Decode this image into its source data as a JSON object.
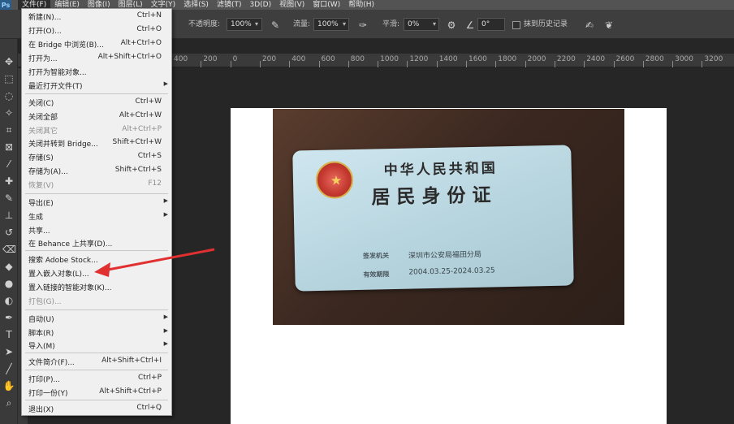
{
  "menubar": {
    "logo": "Ps",
    "items": [
      "文件(F)",
      "编辑(E)",
      "图像(I)",
      "图层(L)",
      "文字(Y)",
      "选择(S)",
      "滤镜(T)",
      "3D(D)",
      "视图(V)",
      "窗口(W)",
      "帮助(H)"
    ]
  },
  "options": {
    "opacity_label": "不透明度:",
    "opacity_value": "100%",
    "flow_label": "流量:",
    "flow_value": "100%",
    "smoothing_label": "平滑:",
    "smoothing_value": "0%",
    "angle_value": "0°",
    "history_label": "抹到历史记录"
  },
  "ruler": {
    "ticks": [
      "400",
      "200",
      "0",
      "200",
      "400",
      "600",
      "800",
      "1000",
      "1200",
      "1400",
      "1600",
      "1800",
      "2000",
      "2200",
      "2400",
      "2600",
      "2800",
      "3000",
      "3200"
    ]
  },
  "file_menu": {
    "items": [
      {
        "label": "新建(N)...",
        "shortcut": "Ctrl+N"
      },
      {
        "label": "打开(O)...",
        "shortcut": "Ctrl+O"
      },
      {
        "label": "在 Bridge 中浏览(B)...",
        "shortcut": "Alt+Ctrl+O"
      },
      {
        "label": "打开为...",
        "shortcut": "Alt+Shift+Ctrl+O"
      },
      {
        "label": "打开为智能对象...",
        "shortcut": ""
      },
      {
        "label": "最近打开文件(T)",
        "shortcut": ""
      },
      {
        "label": "关闭(C)",
        "shortcut": "Ctrl+W"
      },
      {
        "label": "关闭全部",
        "shortcut": "Alt+Ctrl+W"
      },
      {
        "label": "关闭其它",
        "shortcut": "Alt+Ctrl+P"
      },
      {
        "label": "关闭并转到 Bridge...",
        "shortcut": "Shift+Ctrl+W"
      },
      {
        "label": "存储(S)",
        "shortcut": "Ctrl+S"
      },
      {
        "label": "存储为(A)...",
        "shortcut": "Shift+Ctrl+S"
      },
      {
        "label": "恢复(V)",
        "shortcut": "F12"
      },
      {
        "label": "导出(E)",
        "shortcut": ""
      },
      {
        "label": "生成",
        "shortcut": ""
      },
      {
        "label": "共享...",
        "shortcut": ""
      },
      {
        "label": "在 Behance 上共享(D)...",
        "shortcut": ""
      },
      {
        "label": "搜索 Adobe Stock...",
        "shortcut": ""
      },
      {
        "label": "置入嵌入对象(L)...",
        "shortcut": ""
      },
      {
        "label": "置入链接的智能对象(K)...",
        "shortcut": ""
      },
      {
        "label": "打包(G)...",
        "shortcut": ""
      },
      {
        "label": "自动(U)",
        "shortcut": ""
      },
      {
        "label": "脚本(R)",
        "shortcut": ""
      },
      {
        "label": "导入(M)",
        "shortcut": ""
      },
      {
        "label": "文件简介(F)...",
        "shortcut": "Alt+Shift+Ctrl+I"
      },
      {
        "label": "打印(P)...",
        "shortcut": "Ctrl+P"
      },
      {
        "label": "打印一份(Y)",
        "shortcut": "Alt+Shift+Ctrl+P"
      },
      {
        "label": "退出(X)",
        "shortcut": "Ctrl+Q"
      }
    ]
  },
  "id_card": {
    "title_line1": "中华人民共和国",
    "title_line2": "居民身份证",
    "authority_label": "签发机关",
    "authority_value": "深圳市公安局福田分局",
    "validity_label": "有效期限",
    "validity_value": "2004.03.25-2024.03.25"
  },
  "colors": {
    "menubar_bg": "#535353",
    "panel_bg": "#3e3e3e",
    "canvas_bg": "#262626",
    "menu_bg": "#f0f0f0",
    "annotation_red": "#e03030"
  },
  "icons": [
    "ps-logo-icon",
    "brush-settings-icon",
    "airbrush-icon",
    "gear-icon",
    "angle-icon",
    "pressure-icon",
    "butterfly-icon"
  ]
}
